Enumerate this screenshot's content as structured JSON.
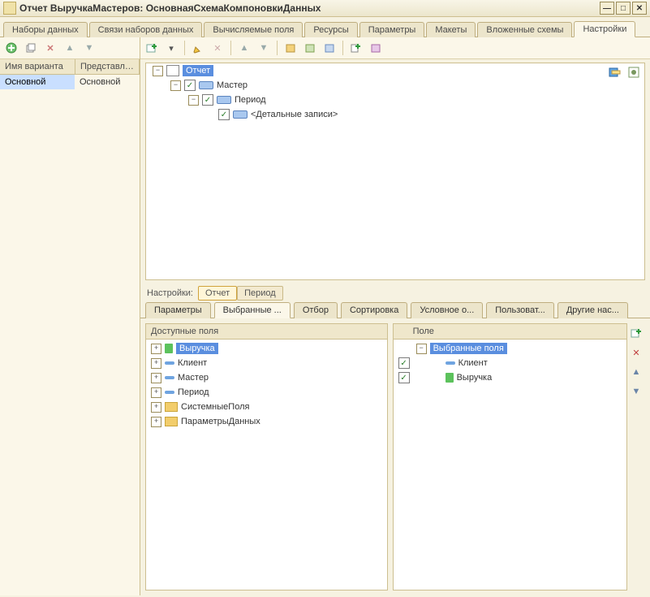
{
  "window": {
    "title": "Отчет ВыручкаМастеров: ОсновнаяСхемаКомпоновкиДанных"
  },
  "main_tabs": {
    "items": [
      "Наборы данных",
      "Связи наборов данных",
      "Вычисляемые поля",
      "Ресурсы",
      "Параметры",
      "Макеты",
      "Вложенные схемы",
      "Настройки"
    ],
    "active_index": 7
  },
  "left_grid": {
    "headers": [
      "Имя варианта",
      "Представле..."
    ],
    "rows": [
      {
        "name": "Основной",
        "repr": "Основной"
      }
    ]
  },
  "report_tree": {
    "nodes": [
      {
        "level": 0,
        "expand": "-",
        "icon": "doc",
        "check": null,
        "label": "Отчет",
        "selected": true
      },
      {
        "level": 1,
        "expand": "-",
        "icon": "field",
        "check": true,
        "label": "Мастер"
      },
      {
        "level": 2,
        "expand": "-",
        "icon": "field",
        "check": true,
        "label": "Период"
      },
      {
        "level": 3,
        "expand": null,
        "icon": "field",
        "check": true,
        "label": "<Детальные записи>"
      }
    ]
  },
  "breadcrumb": {
    "label": "Настройки:",
    "items": [
      "Отчет",
      "Период"
    ],
    "active_index": 0
  },
  "sub_tabs": {
    "items": [
      "Параметры",
      "Выбранные ...",
      "Отбор",
      "Сортировка",
      "Условное о...",
      "Пользоват...",
      "Другие нас..."
    ],
    "active_index": 1
  },
  "available_fields": {
    "title": "Доступные поля",
    "items": [
      {
        "icon": "money",
        "label": "Выручка",
        "selected": true
      },
      {
        "icon": "dash",
        "label": "Клиент"
      },
      {
        "icon": "dash",
        "label": "Мастер"
      },
      {
        "icon": "dash",
        "label": "Период"
      },
      {
        "icon": "folder",
        "label": "СистемныеПоля"
      },
      {
        "icon": "folder",
        "label": "ПараметрыДанных"
      }
    ]
  },
  "selected_fields": {
    "title": "Поле",
    "root": "Выбранные поля",
    "items": [
      {
        "icon": "dash",
        "check": true,
        "label": "Клиент"
      },
      {
        "icon": "money",
        "check": true,
        "label": "Выручка"
      }
    ]
  }
}
